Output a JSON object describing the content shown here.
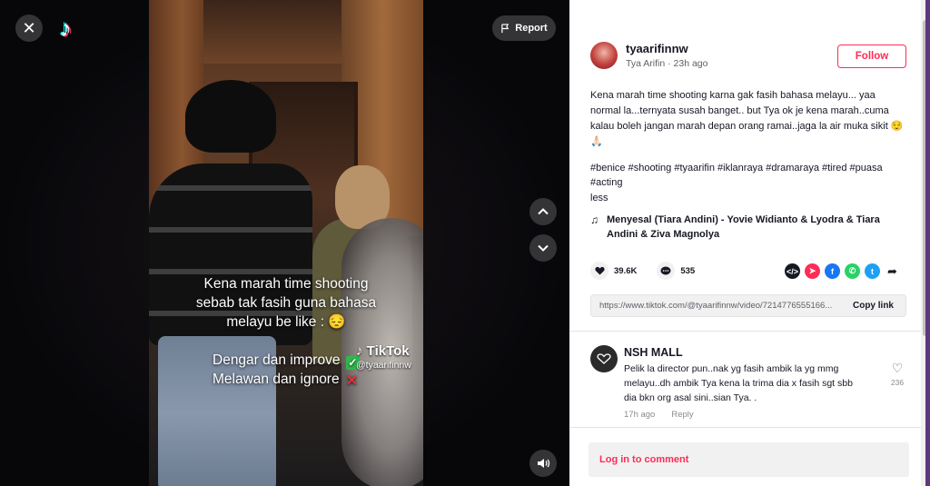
{
  "player": {
    "close_icon": "✕",
    "logo_icon": "♪",
    "report_label": "Report",
    "up_icon": "chevron-up",
    "down_icon": "chevron-down",
    "volume_icon": "speaker",
    "caption_lines": [
      "Kena marah time shooting",
      "sebab tak fasih guna bahasa",
      "melayu be like : 😔"
    ],
    "caption_option_1": "Dengar dan improve",
    "caption_option_2": "Melawan dan ignore",
    "watermark_logo": "TikTok",
    "watermark_user": "@tyaarifinnw"
  },
  "author": {
    "username": "tyaarifinnw",
    "display_name": "Tya Arifin",
    "separator": "·",
    "posted": "23h ago",
    "follow_label": "Follow"
  },
  "post": {
    "description": "Kena marah time shooting karna gak fasih bahasa melayu... yaa normal la...ternyata susah banget.. but Tya ok je kena marah..cuma kalau boleh jangan marah depan orang ramai..jaga la air muka sikit 😌🙏🏻",
    "hashtags": "#benice #shooting #tyaarifin #iklanraya #dramaraya #tired #puasa #acting",
    "less_label": "less",
    "music": "Menyesal (Tiara Andini) - Yovie Widianto & Lyodra & Tiara Andini & Ziva Magnolya",
    "likes": "39.6K",
    "comments_count": "535",
    "share_icons": [
      "embed-icon",
      "send-icon",
      "facebook-icon",
      "whatsapp-icon",
      "twitter-icon",
      "share-arrow-icon"
    ],
    "share_colors": [
      "#161823",
      "#fe2c55",
      "#1877f2",
      "#25d366",
      "#1da1f2"
    ],
    "link": "https://www.tiktok.com/@tyaarifinnw/video/7214776555166...",
    "copy_label": "Copy link"
  },
  "comments": [
    {
      "name": "NSH MALL",
      "text": "Pelik la director pun..nak yg fasih ambik la yg mmg melayu..dh ambik Tya kena la trima dia x fasih sgt sbb dia bkn org asal sini..sian Tya. .",
      "time": "17h ago",
      "reply_label": "Reply",
      "likes": "236"
    }
  ],
  "login": {
    "label": "Log in to comment"
  }
}
